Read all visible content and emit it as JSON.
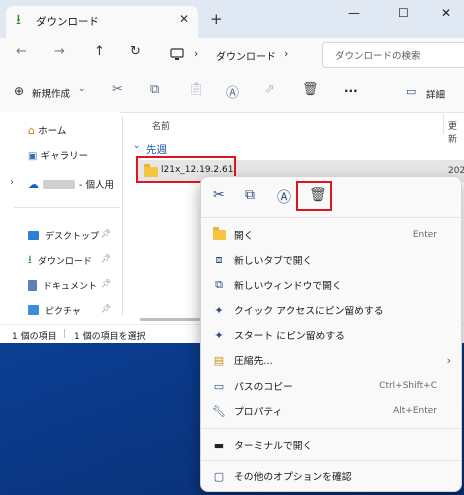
{
  "window": {
    "tab_title": "ダウンロード",
    "tab_close": "✕",
    "new_tab": "+",
    "controls": {
      "minimize": "—",
      "maximize": "☐",
      "close": "✕"
    }
  },
  "address": {
    "crumb_location": "ダウンロード",
    "crumb_sep": "›",
    "search_placeholder": "ダウンロードの検索"
  },
  "toolbar": {
    "new_label": "新規作成",
    "new_chevron": "⌄",
    "more": "···",
    "details_label": "詳細"
  },
  "sidebar": {
    "items": [
      {
        "label": "ホーム",
        "icon": "home-icon"
      },
      {
        "label": "ギャラリー",
        "icon": "gallery-icon"
      },
      {
        "label": "- 個人用",
        "icon": "onedrive-icon"
      },
      {
        "label": "デスクトップ",
        "icon": "desktop-icon"
      },
      {
        "label": "ダウンロード",
        "icon": "download-icon"
      },
      {
        "label": "ドキュメント",
        "icon": "document-icon"
      },
      {
        "label": "ピクチャ",
        "icon": "pictures-icon"
      }
    ]
  },
  "main": {
    "col_name": "名前",
    "col_date": "更新",
    "group_label": "先週",
    "file_name": "l21x_12.19.2.61",
    "file_date": "202"
  },
  "status": {
    "items_count": "1 個の項目",
    "selected_count": "1 個の項目を選択"
  },
  "context_menu": {
    "items": [
      {
        "label": "開く",
        "shortcut": "Enter",
        "icon": "folder-open-icon"
      },
      {
        "label": "新しいタブで開く",
        "shortcut": "",
        "icon": "new-tab-icon"
      },
      {
        "label": "新しいウィンドウで開く",
        "shortcut": "",
        "icon": "new-window-icon"
      },
      {
        "label": "クイック アクセスにピン留めする",
        "shortcut": "",
        "icon": "pin-icon"
      },
      {
        "label": "スタート にピン留めする",
        "shortcut": "",
        "icon": "pin-start-icon"
      },
      {
        "label": "圧縮先...",
        "shortcut": "",
        "icon": "zip-icon"
      },
      {
        "label": "パスのコピー",
        "shortcut": "Ctrl+Shift+C",
        "icon": "copy-path-icon"
      },
      {
        "label": "プロパティ",
        "shortcut": "Alt+Enter",
        "icon": "properties-icon"
      },
      {
        "label": "ターミナルで開く",
        "shortcut": "",
        "icon": "terminal-icon"
      },
      {
        "label": "その他のオプションを確認",
        "shortcut": "",
        "icon": "more-options-icon"
      }
    ]
  },
  "colors": {
    "highlight": "#e0141e",
    "accent": "#0067c0"
  }
}
